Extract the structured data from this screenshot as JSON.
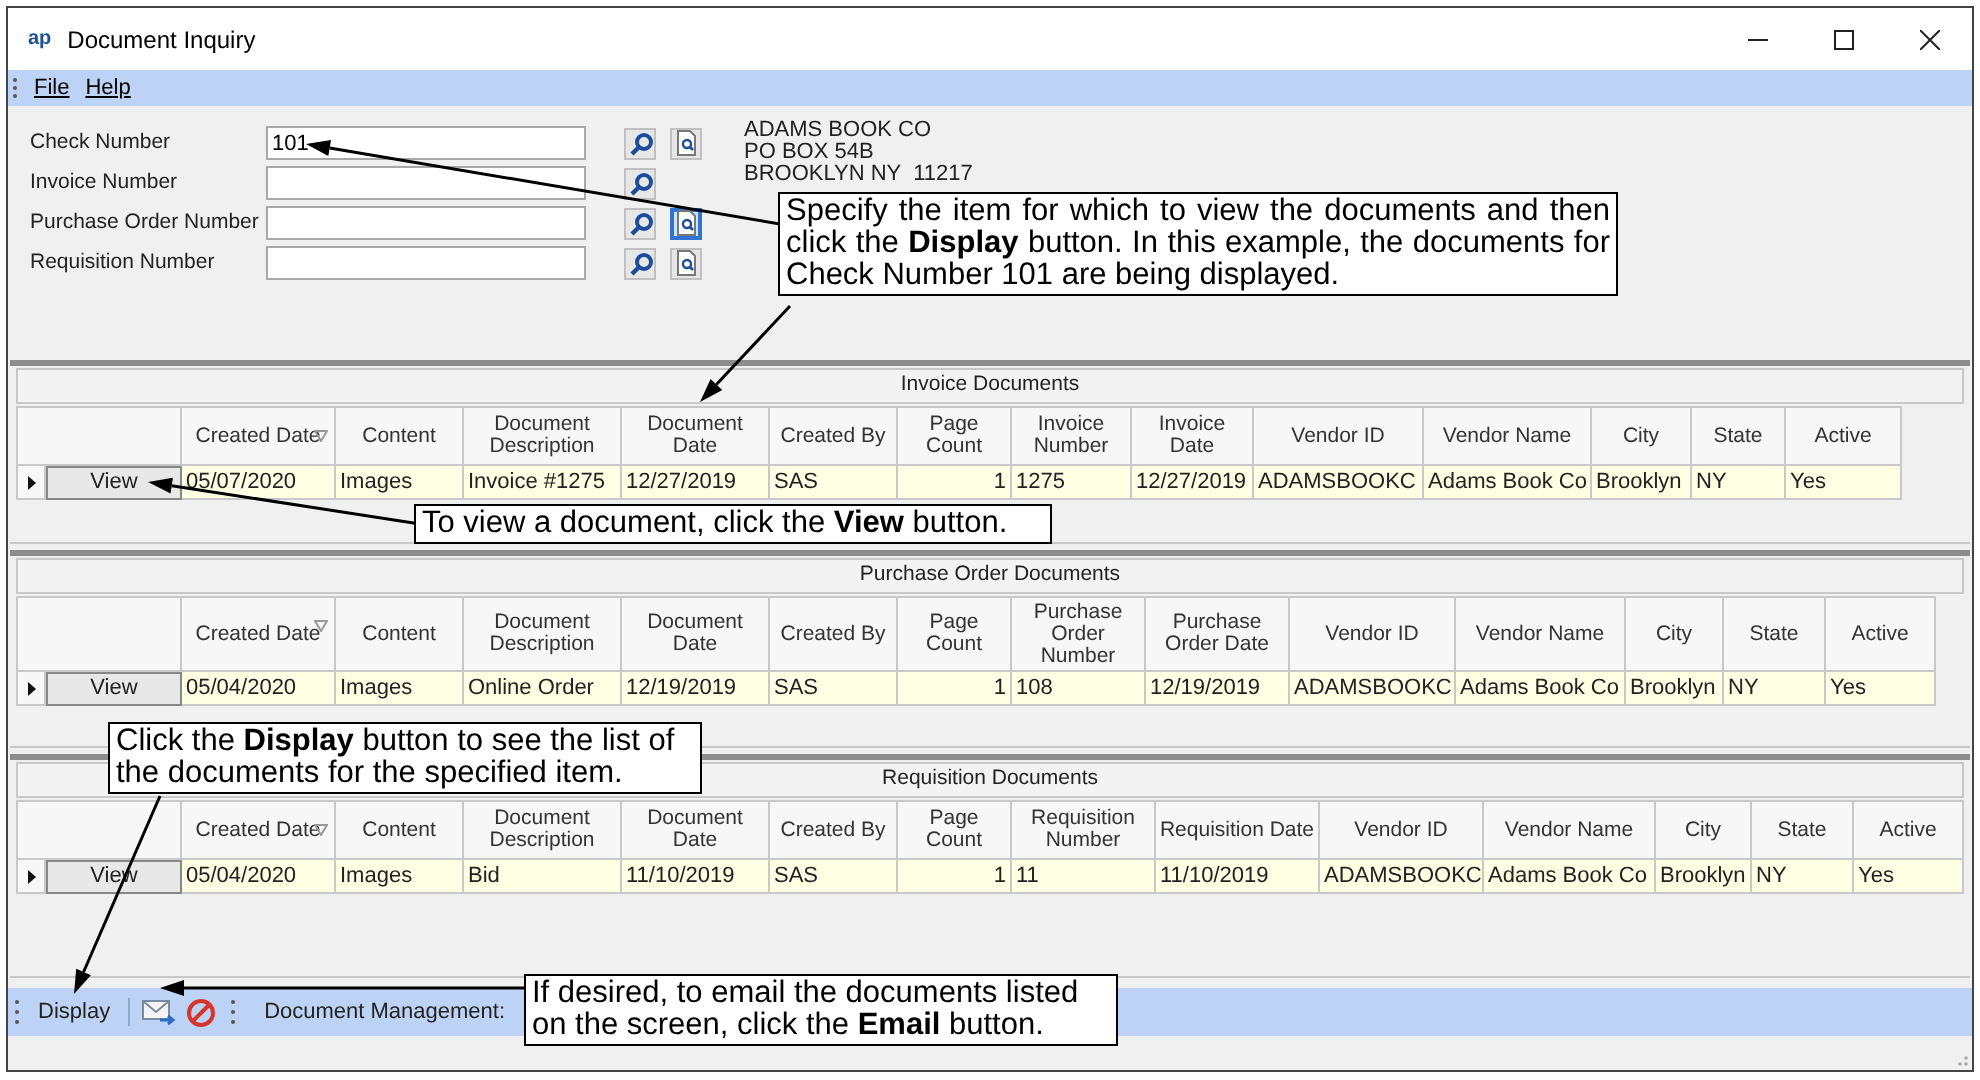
{
  "window": {
    "app_badge": "ap",
    "title": "Document Inquiry"
  },
  "menu": [
    "File",
    "Help"
  ],
  "fields": [
    {
      "label": "Check Number",
      "value": "101",
      "preview": true
    },
    {
      "label": "Invoice Number"
    },
    {
      "label": "Purchase Order Number",
      "preview": true,
      "preview_focused": true
    },
    {
      "label": "Requisition Number",
      "preview": true
    }
  ],
  "vendor_address": [
    "ADAMS BOOK CO",
    "PO BOX 54B",
    "BROOKLYN NY  11217"
  ],
  "grids": [
    {
      "title": "Invoice Documents",
      "columns": [
        {
          "label": "Created Date",
          "sorted": true
        },
        {
          "label": "Content"
        },
        {
          "label": "Document Description"
        },
        {
          "label": "Document Date"
        },
        {
          "label": "Created By"
        },
        {
          "label": "Page Count"
        },
        {
          "label": "Invoice Number"
        },
        {
          "label": "Invoice Date"
        },
        {
          "label": "Vendor ID"
        },
        {
          "label": "Vendor Name"
        },
        {
          "label": "City"
        },
        {
          "label": "State"
        },
        {
          "label": "Active"
        }
      ],
      "rows": [
        {
          "current": true,
          "button": "View",
          "cells": [
            "05/07/2020",
            "Images",
            "Invoice #1275",
            "12/27/2019",
            "SAS",
            "1",
            "1275",
            "12/27/2019",
            "ADAMSBOOKC",
            "Adams Book Co",
            "Brooklyn",
            "NY",
            "Yes"
          ]
        }
      ]
    },
    {
      "title": "Purchase Order Documents",
      "columns": [
        {
          "label": "Created Date",
          "sorted": true
        },
        {
          "label": "Content"
        },
        {
          "label": "Document Description"
        },
        {
          "label": "Document Date"
        },
        {
          "label": "Created By"
        },
        {
          "label": "Page Count"
        },
        {
          "label": "Purchase Order Number"
        },
        {
          "label": "Purchase Order Date"
        },
        {
          "label": "Vendor ID"
        },
        {
          "label": "Vendor Name"
        },
        {
          "label": "City"
        },
        {
          "label": "State"
        },
        {
          "label": "Active"
        }
      ],
      "rows": [
        {
          "current": true,
          "button": "View",
          "cells": [
            "05/04/2020",
            "Images",
            "Online Order",
            "12/19/2019",
            "SAS",
            "1",
            "108",
            "12/19/2019",
            "ADAMSBOOKC",
            "Adams Book Co",
            "Brooklyn",
            "NY",
            "Yes"
          ]
        }
      ]
    },
    {
      "title": "Requisition Documents",
      "columns": [
        {
          "label": "Created Date",
          "sorted": true
        },
        {
          "label": "Content"
        },
        {
          "label": "Document Description"
        },
        {
          "label": "Document Date"
        },
        {
          "label": "Created By"
        },
        {
          "label": "Page Count"
        },
        {
          "label": "Requisition Number"
        },
        {
          "label": "Requisition Date"
        },
        {
          "label": "Vendor ID"
        },
        {
          "label": "Vendor Name"
        },
        {
          "label": "City"
        },
        {
          "label": "State"
        },
        {
          "label": "Active"
        }
      ],
      "rows": [
        {
          "current": true,
          "button": "View",
          "cells": [
            "05/04/2020",
            "Images",
            "Bid",
            "11/10/2019",
            "SAS",
            "1",
            "11",
            "11/10/2019",
            "ADAMSBOOKC",
            "Adams Book Co",
            "Brooklyn",
            "NY",
            "Yes"
          ]
        }
      ]
    }
  ],
  "toolbar": {
    "display": "Display",
    "section_label": "Document Management:"
  },
  "callouts": [
    "Specify the item for which to view the documents and then click the **Display** button.  In this example, the documents for Check Number 101 are being displayed.",
    "To view a document, click the **View** button.",
    "Click the **Display** button to see the list of the documents for the specified item.",
    "If desired, to email the documents listed on the screen, click the **Email** button."
  ]
}
